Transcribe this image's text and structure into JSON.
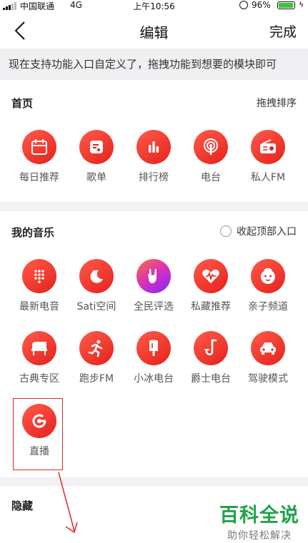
{
  "status_bar": {
    "carrier": "中国联通",
    "network": "4G",
    "time": "上午10:56",
    "battery": "96%",
    "battery_level": 0.96
  },
  "nav": {
    "title": "编辑",
    "done_label": "完成"
  },
  "notice": "现在支持功能入口自定义了，拖拽功能到想要的模块即可",
  "home": {
    "title": "首页",
    "action": "拖拽排序",
    "items": [
      {
        "label": "每日推荐",
        "icon": "calendar-icon"
      },
      {
        "label": "歌单",
        "icon": "playlist-icon"
      },
      {
        "label": "排行榜",
        "icon": "chart-bars-icon"
      },
      {
        "label": "电台",
        "icon": "podcast-icon"
      },
      {
        "label": "私人FM",
        "icon": "radio-icon"
      }
    ]
  },
  "my_music": {
    "title": "我的音乐",
    "collapse_label": "收起顶部入口",
    "items": [
      {
        "label": "最新电音",
        "icon": "dots-grid-icon"
      },
      {
        "label": "Sati空间",
        "icon": "moon-icon"
      },
      {
        "label": "全民评选",
        "icon": "rock-hand-icon"
      },
      {
        "label": "私藏推荐",
        "icon": "heart-wave-icon"
      },
      {
        "label": "亲子频道",
        "icon": "baby-face-icon"
      },
      {
        "label": "古典专区",
        "icon": "piano-icon"
      },
      {
        "label": "跑步FM",
        "icon": "runner-icon"
      },
      {
        "label": "小冰电台",
        "icon": "ice-pop-icon"
      },
      {
        "label": "爵士电台",
        "icon": "saxophone-icon"
      },
      {
        "label": "驾驶模式",
        "icon": "car-icon"
      },
      {
        "label": "直播",
        "icon": "live-icon"
      }
    ]
  },
  "hidden": {
    "title": "隐藏"
  },
  "watermark": {
    "brand": "百科全说",
    "slogan": "助你轻松解决"
  },
  "colors": {
    "accent": "#e4221c",
    "annotation": "#e0282c",
    "watermark": "#21a24a",
    "battery": "#3ac43e"
  }
}
